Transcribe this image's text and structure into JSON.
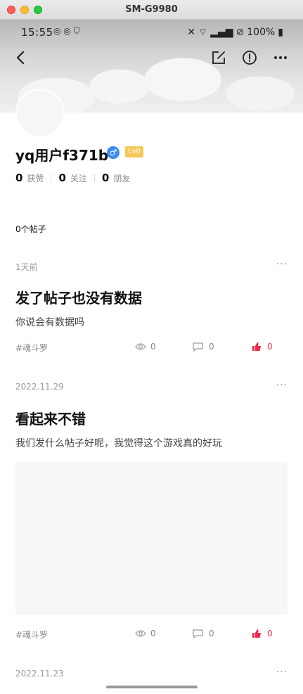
{
  "window": {
    "title": "SM-G9980"
  },
  "status_bar": {
    "time": "15:55",
    "battery": "100%"
  },
  "profile": {
    "name": "yq用户f371b",
    "level": "Lv0",
    "stats": [
      {
        "value": "0",
        "label": "获赞"
      },
      {
        "value": "0",
        "label": "关注"
      },
      {
        "value": "0",
        "label": "朋友"
      }
    ],
    "post_count": "0个帖子"
  },
  "posts": [
    {
      "date": "1天前",
      "title": "发了帖子也没有数据",
      "body": "你说会有数据吗",
      "tag": "#魂斗罗",
      "views": "0",
      "comments": "0",
      "likes": "0",
      "has_image": false
    },
    {
      "date": "2022.11.29",
      "title": "看起来不错",
      "body": "我们发什么帖子好呢，我觉得这个游戏真的好玩",
      "tag": "#魂斗罗",
      "views": "0",
      "comments": "0",
      "likes": "0",
      "has_image": true
    },
    {
      "date": "2022.11.23"
    }
  ],
  "colors": {
    "like": "#ee2d4c",
    "gender": "#3b8cf0",
    "level": "#f6c85a"
  }
}
